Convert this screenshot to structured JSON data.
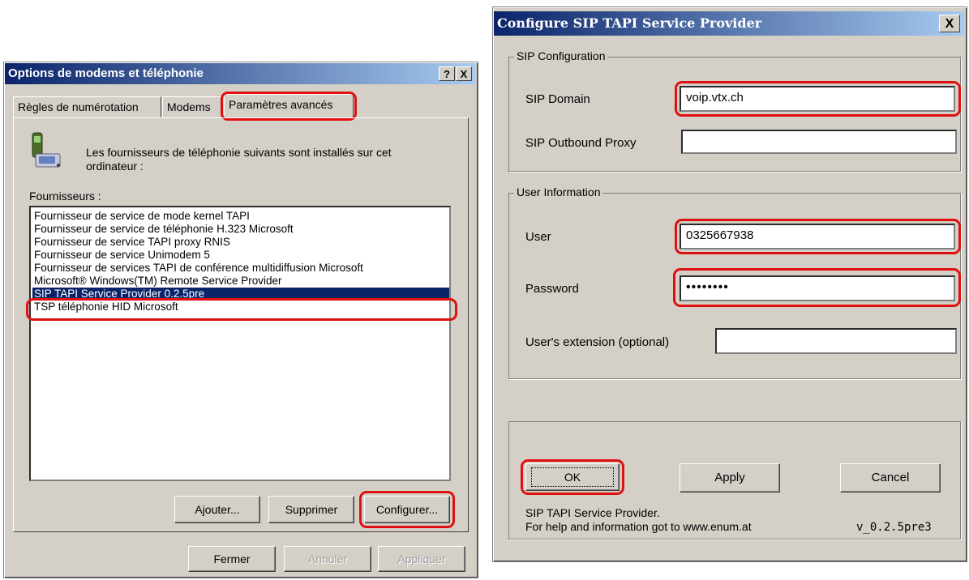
{
  "left_window": {
    "title": "Options de modems et téléphonie",
    "help_btn": "?",
    "close_btn": "X",
    "tabs": [
      "Règles de numérotation",
      "Modems",
      "Paramètres avancés"
    ],
    "description": "Les fournisseurs de téléphonie suivants sont installés sur cet ordinateur :",
    "providers_label": "Fournisseurs :",
    "providers": [
      "Fournisseur de service de mode kernel TAPI",
      "Fournisseur de service de téléphonie H.323 Microsoft",
      "Fournisseur de service TAPI proxy RNIS",
      "Fournisseur de service Unimodem 5",
      "Fournisseur de services TAPI de conférence multidiffusion Microsoft",
      "Microsoft® Windows(TM) Remote Service Provider",
      "SIP TAPI Service Provider 0.2.5pre",
      "TSP téléphonie HID Microsoft"
    ],
    "selected_provider": "SIP TAPI Service Provider 0.2.5pre",
    "buttons": {
      "add": "Ajouter...",
      "remove": "Supprimer",
      "configure": "Configurer..."
    },
    "footer_buttons": {
      "close": "Fermer",
      "cancel": "Annuler",
      "apply": "Appliquer"
    }
  },
  "right_window": {
    "title": "Configure SIP TAPI Service Provider",
    "close_btn": "X",
    "sip_group": "SIP Configuration",
    "sip_domain_label": "SIP Domain",
    "sip_domain_value": "voip.vtx.ch",
    "outbound_proxy_label": "SIP Outbound Proxy",
    "outbound_proxy_value": "",
    "user_group": "User Information",
    "user_label": "User",
    "user_value": "0325667938",
    "password_label": "Password",
    "password_value": "••••••••",
    "extension_label": "User's extension (optional)",
    "extension_value": "",
    "buttons": {
      "ok": "OK",
      "apply": "Apply",
      "cancel": "Cancel"
    },
    "footer_line1": "SIP TAPI Service Provider.",
    "footer_line2": "For help and information got to www.enum.at",
    "version": "v_0.2.5pre3"
  },
  "colors": {
    "highlight": "#e01010",
    "titlebar": "#0a246a",
    "selection": "#0a246a",
    "face": "#d4d0c8"
  }
}
